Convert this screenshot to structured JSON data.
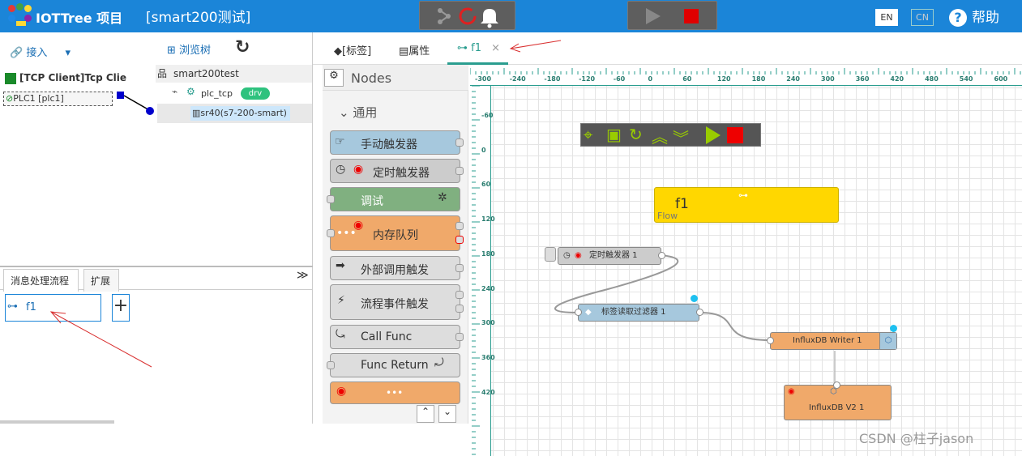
{
  "header": {
    "app_title": "IOTTree 项目",
    "project_title": "[smart200测试]",
    "lang_en": "EN",
    "lang_cn": "CN",
    "help_label": "帮助"
  },
  "left_panel": {
    "connect_label": "接入",
    "browse_tree_label": "浏览树",
    "connector_title": "[TCP Client]Tcp Clie",
    "connector_item": "PLC1 [plc1]",
    "tree_root": "smart200test",
    "tree_child": "plc_tcp",
    "tree_badge": "drv",
    "tree_device": "sr40(s7-200-smart)",
    "tabs": [
      "消息处理流程",
      "扩展"
    ],
    "flow_item": "f1",
    "add_button": "+"
  },
  "main_tabs": {
    "tags": "[标签]",
    "props": "属性",
    "flow": "f1",
    "close": "×"
  },
  "palette": {
    "title": "Nodes",
    "section": "通用",
    "nodes": [
      "手动触发器",
      "定时触发器",
      "调试",
      "内存队列",
      "外部调用触发",
      "流程事件触发",
      "Call Func",
      "Func Return",
      "•••"
    ]
  },
  "ruler": {
    "x_labels": [
      "-300",
      "-240",
      "-180",
      "-120",
      "-60",
      "0",
      "60",
      "120",
      "180",
      "240",
      "300",
      "360",
      "420",
      "480",
      "540",
      "600"
    ],
    "y_labels": [
      "-60",
      "0",
      "60",
      "120",
      "180",
      "240",
      "300",
      "360",
      "420"
    ]
  },
  "canvas": {
    "flow_node_title": "f1",
    "flow_node_sub": "Flow",
    "nodes": {
      "timer": "定时触发器 1",
      "filter": "标签读取过滤器 1",
      "influx1": "InfluxDB Writer 1",
      "influx2": "InfluxDB V2 1"
    }
  },
  "watermark": "CSDN @柱子jason",
  "colors": {
    "header_bg": "#1b85d8",
    "accent_teal": "#2a9d8f",
    "node_orange": "#f0a96a",
    "node_blue": "#a6c8dd",
    "node_green": "#80b080",
    "flow_yellow": "#ffd700"
  }
}
